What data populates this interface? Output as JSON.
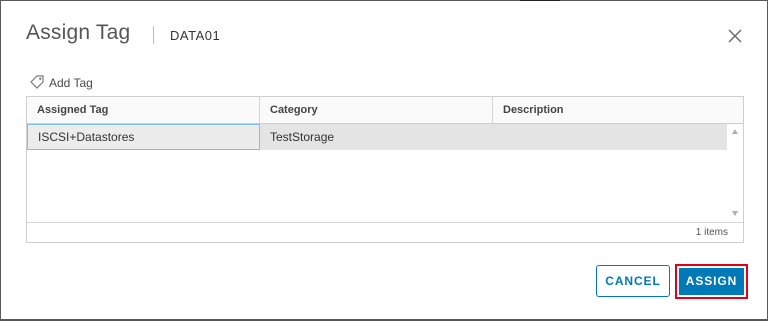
{
  "dialog": {
    "title": "Assign Tag",
    "subtitle": "DATA01"
  },
  "toolbar": {
    "add_tag_label": "Add Tag"
  },
  "grid": {
    "columns": [
      "Assigned Tag",
      "Category",
      "Description"
    ],
    "rows": [
      {
        "assigned_tag": "ISCSI+Datastores",
        "category": "TestStorage",
        "description": ""
      }
    ],
    "footer_count": "1 items"
  },
  "buttons": {
    "cancel": "CANCEL",
    "assign": "ASSIGN"
  },
  "icons": {
    "close": "close-icon",
    "tag": "tag-icon",
    "scroll_up": "scroll-up-arrow-icon",
    "scroll_down": "scroll-down-arrow-icon"
  },
  "colors": {
    "primary": "#0079b8",
    "highlight_border": "#e0001b",
    "selected_cell_border": "#7fc2e8"
  }
}
